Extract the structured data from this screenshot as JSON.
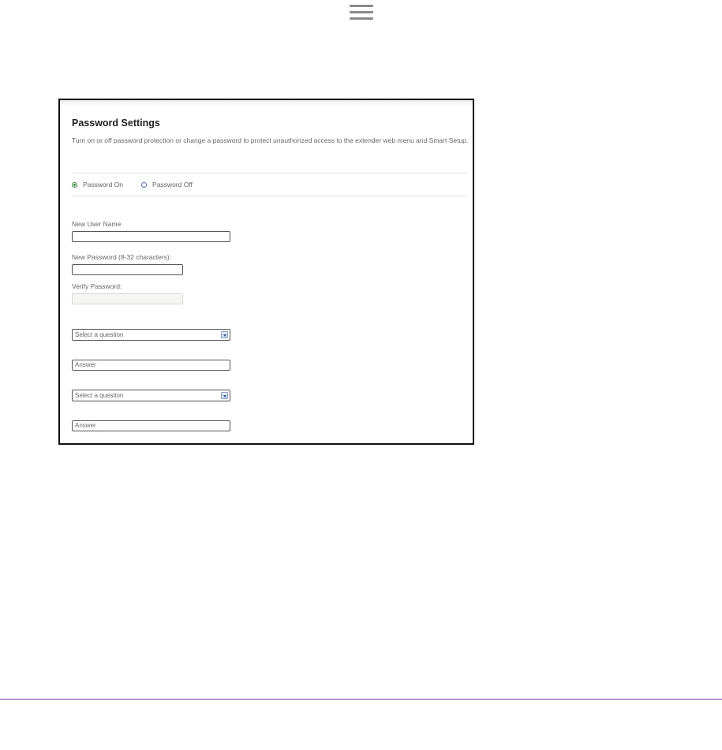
{
  "form": {
    "title": "Password Settings",
    "description": "Turn on or off password protection or change a password to protect unauthorized access to the extender web menu and Smart Setup.",
    "radio": {
      "on_label": "Password On",
      "off_label": "Password Off",
      "selected": "on"
    },
    "fields": {
      "username_label": "New User Name",
      "password_label": "New Password (8-32 characters):",
      "verify_label": "Verify Password:"
    },
    "security_questions": [
      {
        "question": "Select a question",
        "answer": "Answer"
      },
      {
        "question": "Select a question",
        "answer": "Answer"
      }
    ]
  },
  "colors": {
    "footer_rule": "#6a3aa6",
    "radio_selected": "#3f8a4a",
    "radio_unselected": "#4c6fae"
  }
}
